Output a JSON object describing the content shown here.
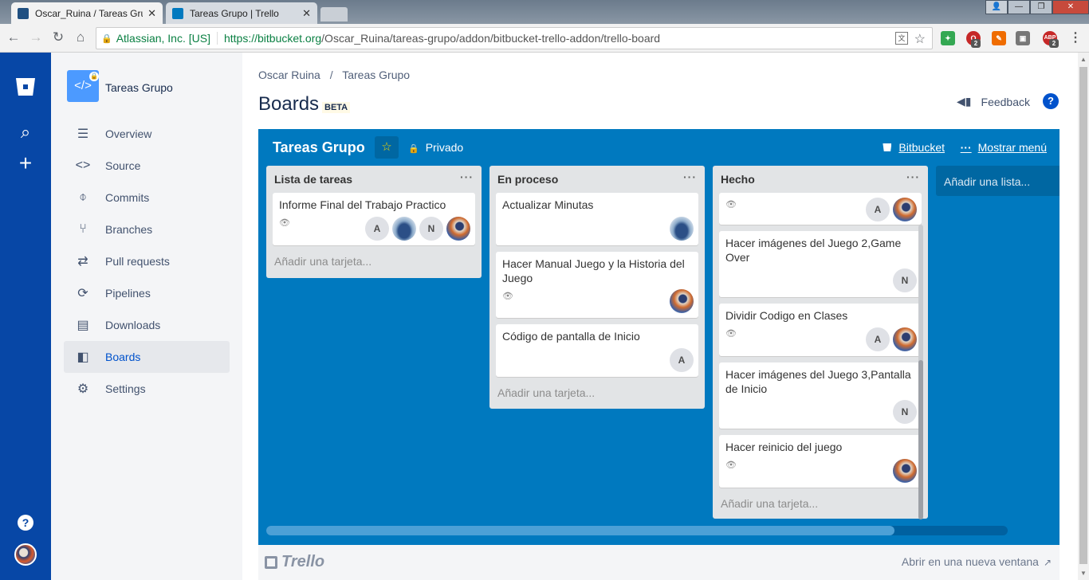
{
  "browser": {
    "tabs": [
      {
        "title": "Oscar_Ruina / Tareas Gru",
        "close": "✕",
        "color": "#205081"
      },
      {
        "title": "Tareas Grupo | Trello",
        "close": "✕",
        "color": "#0079bf"
      }
    ],
    "omnibox": {
      "ev_label": "Atlassian, Inc. [US]",
      "url_host": "https://bitbucket.org",
      "url_path": "/Oscar_Ruina/tareas-grupo/addon/bitbucket-trello-addon/trello-board"
    },
    "ext_badges": [
      "2",
      "2"
    ]
  },
  "sidebar": {
    "repo_name": "Tareas Grupo",
    "items": [
      {
        "label": "Overview",
        "icon": "overview-icon"
      },
      {
        "label": "Source",
        "icon": "source-icon"
      },
      {
        "label": "Commits",
        "icon": "commits-icon"
      },
      {
        "label": "Branches",
        "icon": "branches-icon"
      },
      {
        "label": "Pull requests",
        "icon": "pull-requests-icon"
      },
      {
        "label": "Pipelines",
        "icon": "pipelines-icon"
      },
      {
        "label": "Downloads",
        "icon": "downloads-icon"
      },
      {
        "label": "Boards",
        "icon": "boards-icon",
        "active": true
      },
      {
        "label": "Settings",
        "icon": "settings-icon"
      }
    ]
  },
  "header": {
    "breadcrumb": [
      "Oscar Ruina",
      "Tareas Grupo"
    ],
    "separator": "/",
    "title": "Boards",
    "badge": "BETA",
    "feedback": "Feedback"
  },
  "board": {
    "title": "Tareas Grupo",
    "visibility": "Privado",
    "bitbucket_link": "Bitbucket",
    "menu_link": "Mostrar menú",
    "add_list": "Añadir una lista...",
    "add_card": "Añadir una tarjeta...",
    "lists": [
      {
        "title": "Lista de tareas",
        "cards": [
          {
            "title": "Informe Final del Trabajo Practico",
            "members": [
              "A",
              "",
              "N",
              ""
            ]
          }
        ]
      },
      {
        "title": "En proceso",
        "cards": [
          {
            "title": "Actualizar Minutas",
            "members": [
              ""
            ]
          },
          {
            "title": "Hacer Manual Juego y la Historia del Juego",
            "members": [
              ""
            ]
          },
          {
            "title": "Código de pantalla de Inicio",
            "members": [
              "A"
            ]
          }
        ]
      },
      {
        "title": "Hecho",
        "cards": [
          {
            "title": "",
            "members": [
              "A",
              ""
            ]
          },
          {
            "title": "Hacer imágenes del Juego 2,Game Over",
            "members": [
              "N"
            ]
          },
          {
            "title": "Dividir Codigo en Clases",
            "members": [
              "A",
              ""
            ]
          },
          {
            "title": "Hacer imágenes del Juego 3,Pantalla de Inicio",
            "members": [
              "N"
            ]
          },
          {
            "title": "Hacer reinicio del juego",
            "members": [
              ""
            ]
          }
        ]
      }
    ]
  },
  "footer": {
    "logo": "Trello",
    "open_new": "Abrir en una nueva ventana"
  },
  "colors": {
    "bitbucket_nav": "#0747a6",
    "board_bg": "#0079bf",
    "link": "#0052cc"
  }
}
